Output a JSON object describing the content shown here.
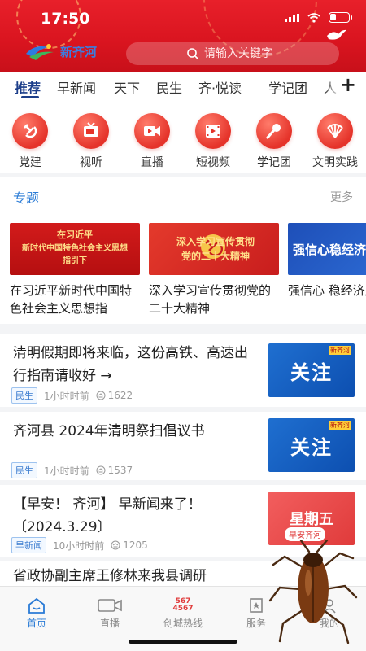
{
  "status": {
    "time": "17:50"
  },
  "header": {
    "logo_text": "新齐河",
    "search_placeholder": "请输入关键字"
  },
  "tabs": [
    {
      "label": "推荐",
      "active": true
    },
    {
      "label": "早新闻"
    },
    {
      "label": "天下"
    },
    {
      "label": "民生"
    },
    {
      "label": "齐·悦读"
    },
    {
      "label": "学记团"
    },
    {
      "label": "人"
    }
  ],
  "quick_links": [
    {
      "label": "党建",
      "icon": "hammer-sickle-icon"
    },
    {
      "label": "视听",
      "icon": "tv-icon"
    },
    {
      "label": "直播",
      "icon": "video-camera-icon"
    },
    {
      "label": "短视频",
      "icon": "film-icon"
    },
    {
      "label": "学记团",
      "icon": "microphone-icon"
    },
    {
      "label": "文明实践",
      "icon": "fan-icon"
    }
  ],
  "topics": {
    "title": "专题",
    "more": "更多",
    "cards": [
      {
        "banner_line1": "在习近平",
        "banner_line2": "新时代中国特色社会主义思想",
        "banner_line3": "指引下",
        "caption": "在习近平新时代中国特色社会主义思想指"
      },
      {
        "banner_line1": "深入学习宣传贯彻",
        "banner_line2": "党的二十大精神",
        "caption": "深入学习宣传贯彻党的二十大精神"
      },
      {
        "banner_line1": "强信心稳经济",
        "caption": "强信心 稳经济展"
      }
    ]
  },
  "news": [
    {
      "title": "清明假期即将来临，这份高铁、高速出行指南请收好 →",
      "tag": "民生",
      "time": "1小时时前",
      "views": "1622",
      "thumb_text": "关注",
      "thumb_badge": "新齐河"
    },
    {
      "title": "齐河县 2024年清明祭扫倡议书",
      "tag": "民生",
      "time": "1小时时前",
      "views": "1537",
      "thumb_text": "关注",
      "thumb_badge": "新齐河"
    },
    {
      "title": "【早安！ 齐河】 早新闻来了！〔2024.3.29〕",
      "tag": "早新闻",
      "time": "10小时时前",
      "views": "1205",
      "thumb_text": "星期五",
      "thumb_badge": "早安齐河"
    },
    {
      "title": "省政协副主席王修林来我县调研"
    }
  ],
  "bottom_nav": [
    {
      "label": "首页",
      "icon": "home-icon",
      "active": true
    },
    {
      "label": "直播",
      "icon": "video-icon"
    },
    {
      "label": "创城热线",
      "icon": "hotline-icon",
      "badge": "567 4567"
    },
    {
      "label": "服务",
      "icon": "service-icon"
    },
    {
      "label": "我的",
      "icon": "user-icon"
    }
  ],
  "colors": {
    "header_red": "#d9141f",
    "accent_blue": "#2a7bd6",
    "tab_active": "#1d3e8a"
  }
}
